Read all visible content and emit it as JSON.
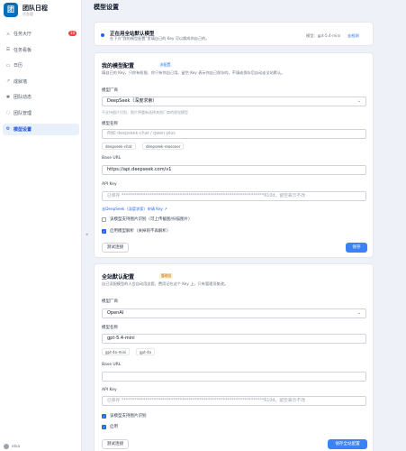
{
  "app": {
    "logo": "团",
    "title": "团队日程",
    "subtitle": "任务管"
  },
  "sidebar": {
    "items": [
      {
        "icon": "⚔",
        "label": "任务大厅",
        "badge": "10"
      },
      {
        "icon": "☰",
        "label": "任务看板"
      },
      {
        "icon": "▭",
        "label": "日历"
      },
      {
        "icon": "↗",
        "label": "成就墙"
      },
      {
        "icon": "✱",
        "label": "团队动态"
      },
      {
        "icon": "◌",
        "label": "团队管理"
      },
      {
        "icon": "⚙",
        "label": "模型设置"
      }
    ],
    "user": "elsa"
  },
  "page_title": "模型设置",
  "banner": {
    "title": "正在用全站默认模型",
    "desc": "在下方\"我的模型配置\"里填自己的 Key 可以换成你自己的。",
    "mode": "模型：gpt-5.4-mini",
    "link": "去检测"
  },
  "my_config": {
    "title": "我的模型配置",
    "tag": "未配置",
    "desc": "填自己的 Key，只你有权限、你只有你自己用。留空 Key 表示你自己保存的，不填或保存后自动走全站默认。",
    "provider_label": "模型厂商",
    "provider_value": "DeepSeek（深度求索）",
    "provider_hint": "不支持图片识别，图片将重新选择其他厂商的视觉模型",
    "model_label": "模型名称",
    "model_placeholder": "例如 deepseek-chat / qwen-plus",
    "model_chips": [
      "deepseek-chat",
      "deepseek-reasoner"
    ],
    "base_url_label": "Base URL",
    "base_url_value": "https://api.deepseek.com/v1",
    "api_key_label": "API Key",
    "api_key_value": "已保存 ******************************************************************610d，留空表示不改",
    "apply_link": "去DeepSeek（深度求索）申请 Key ↗",
    "check1": "该模型支持图片识别（可上传截图/扫描图片）",
    "check2": "启用模型解析（关掉则不再解析）",
    "test_button": "测试连接",
    "save_button": "保存"
  },
  "global_config": {
    "title": "全站默认配置",
    "tag": "管理员",
    "desc": "自己没配模型的人会自动用这套，费用记在这个 Key 上，只有管理员能改。",
    "provider_label": "模型厂商",
    "provider_value": "OpenAI",
    "model_label": "模型名称",
    "model_value": "gpt-5.4-mini",
    "model_chips": [
      "gpt-4o-mini",
      "gpt-4o"
    ],
    "base_url_label": "Base URL",
    "api_key_label": "API Key",
    "api_key_value": "已保存 ******************************************************************610d，留空表示不改",
    "check1": "该模型支持图片识别",
    "check2": "启用",
    "test_button": "测试连接",
    "save_button": "保存全站配置"
  }
}
